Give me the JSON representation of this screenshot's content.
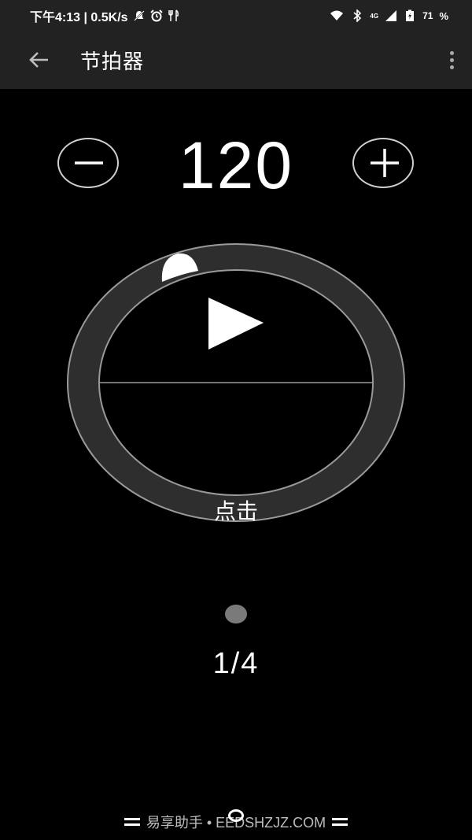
{
  "status_bar": {
    "time_network": "下午4:13 | 0.5K/s",
    "battery": "71",
    "battery_unit": "%",
    "network_type": "4G"
  },
  "app_bar": {
    "title": "节拍器"
  },
  "tempo": {
    "bpm": "120"
  },
  "dial": {
    "tap_label": "点击"
  },
  "time_signature": "1/4",
  "watermark": {
    "text": "易享助手 • EEDSHZJZ.COM"
  },
  "colors": {
    "background": "#000000",
    "bar_background": "#222222",
    "ring": "#2e2e2e",
    "ring_border": "#9a9a9a",
    "beat_dot": "#7a7a7a"
  }
}
